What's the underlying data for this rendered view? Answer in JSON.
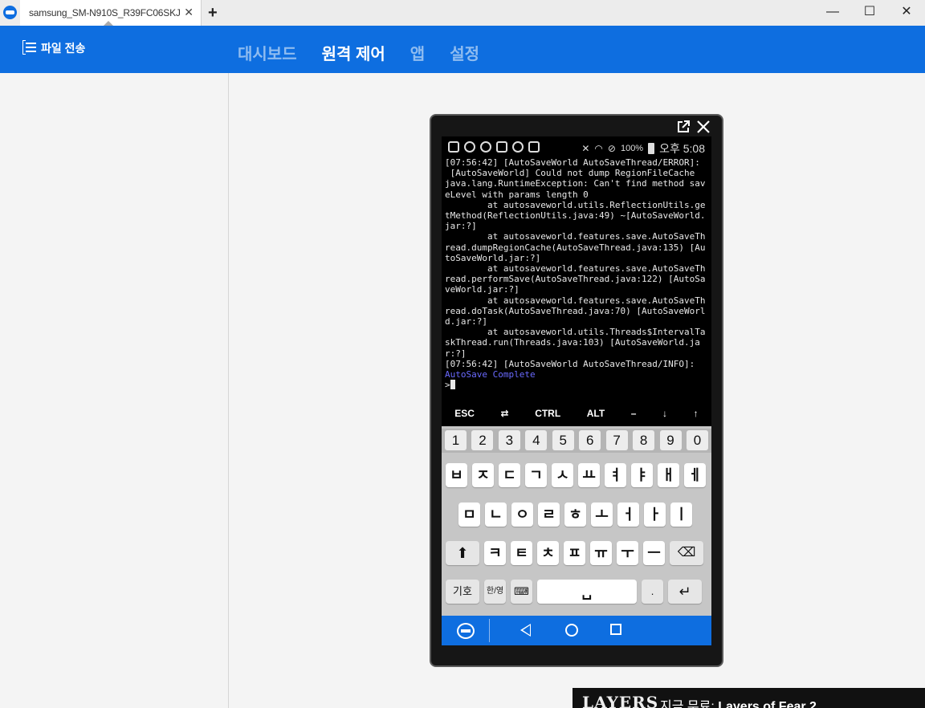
{
  "window": {
    "tab_title": "samsung_SM-N910S_R39FC06SKJ",
    "tab_close": "✕",
    "add_tab": "+",
    "minimize": "—",
    "maximize": "☐",
    "close": "✕"
  },
  "header": {
    "file_transfer": "파일 전송",
    "nav": [
      "대시보드",
      "원격 제어",
      "앱",
      "설정"
    ],
    "active_nav": "원격 제어"
  },
  "phone": {
    "status": {
      "battery": "100%",
      "time": "오후 5:08"
    },
    "terminal_lines": [
      "[07:56:42] [AutoSaveWorld AutoSaveThread/ERROR]:",
      " [AutoSaveWorld] Could not dump RegionFileCache",
      "java.lang.RuntimeException: Can't find method saveLevel with params length 0",
      "        at autosaveworld.utils.ReflectionUtils.getMethod(ReflectionUtils.java:49) ~[AutoSaveWorld.jar:?]",
      "        at autosaveworld.features.save.AutoSaveThread.dumpRegionCache(AutoSaveThread.java:135) [AutoSaveWorld.jar:?]",
      "        at autosaveworld.features.save.AutoSaveThread.performSave(AutoSaveThread.java:122) [AutoSaveWorld.jar:?]",
      "        at autosaveworld.features.save.AutoSaveThread.doTask(AutoSaveThread.java:70) [AutoSaveWorld.jar:?]",
      "        at autosaveworld.utils.Threads$IntervalTaskThread.run(Threads.java:103) [AutoSaveWorld.jar:?]",
      "[07:56:42] [AutoSaveWorld AutoSaveThread/INFO]:"
    ],
    "terminal_highlight": "AutoSave Complete",
    "prompt": ">",
    "extra_keys": [
      "ESC",
      "⇄",
      "CTRL",
      "ALT",
      "–",
      "↓",
      "↑"
    ],
    "keyboard": {
      "numbers": [
        "1",
        "2",
        "3",
        "4",
        "5",
        "6",
        "7",
        "8",
        "9",
        "0"
      ],
      "row1": [
        "ㅂ",
        "ㅈ",
        "ㄷ",
        "ㄱ",
        "ㅅ",
        "ㅛ",
        "ㅕ",
        "ㅑ",
        "ㅐ",
        "ㅔ"
      ],
      "row2": [
        "ㅁ",
        "ㄴ",
        "ㅇ",
        "ㄹ",
        "ㅎ",
        "ㅗ",
        "ㅓ",
        "ㅏ",
        "ㅣ"
      ],
      "row3": [
        "ㅋ",
        "ㅌ",
        "ㅊ",
        "ㅍ",
        "ㅠ",
        "ㅜ",
        "ㅡ"
      ],
      "shift": "⬆",
      "backspace": "⌫",
      "symbols": "기호",
      "lang": "한/영",
      "space": "␣",
      "period": ".",
      "enter": "↵"
    }
  },
  "ad": {
    "logo": "LAYERS",
    "prefix": "지금 무료: ",
    "title": "Layers of Fear 2"
  },
  "colors": {
    "brand_blue": "#0e6ee0",
    "nav_inactive": "#8fbcf0",
    "terminal_highlight": "#6a6aff"
  }
}
